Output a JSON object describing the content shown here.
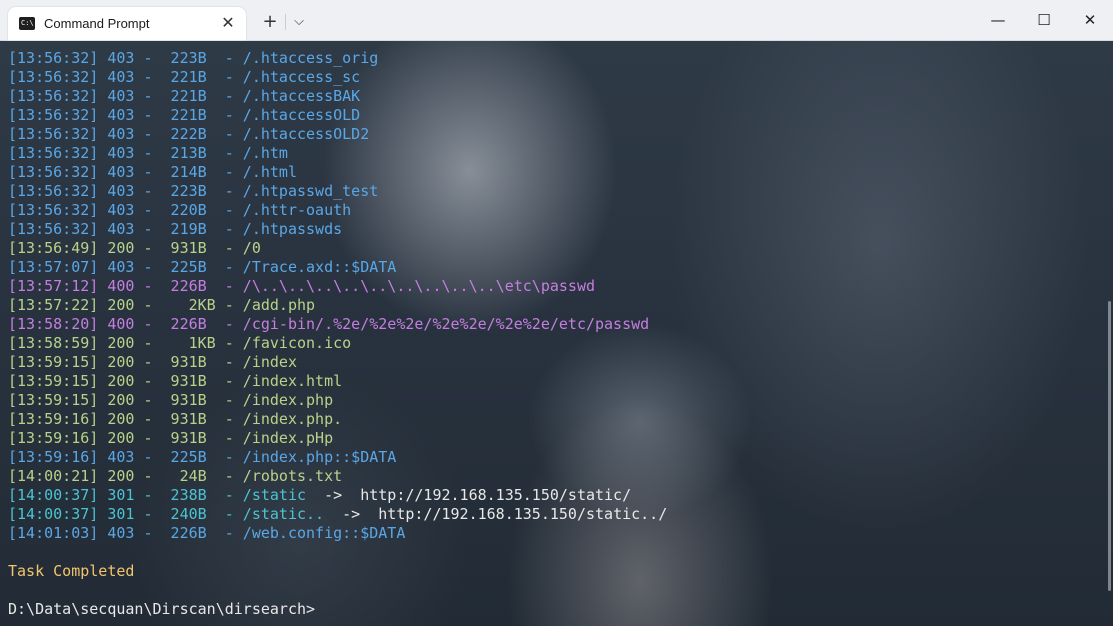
{
  "window": {
    "tab_title": "Command Prompt",
    "tab_icon_text": "C:\\",
    "tab_close": "✕",
    "new_tab": "+",
    "dropdown": "⌵",
    "minimize": "—",
    "maximize": "☐",
    "close": "✕"
  },
  "colors": {
    "403": "#5aa7e6",
    "200": "#b6d389",
    "400": "#c57ee0",
    "301": "#4cc3d2",
    "status_text": "#f2c56c",
    "prompt": "#e8e8e8"
  },
  "log": [
    {
      "text": "[13:56:32] 403 -  223B  - /.htaccess_orig",
      "code": "403"
    },
    {
      "text": "[13:56:32] 403 -  221B  - /.htaccess_sc",
      "code": "403"
    },
    {
      "text": "[13:56:32] 403 -  221B  - /.htaccessBAK",
      "code": "403"
    },
    {
      "text": "[13:56:32] 403 -  221B  - /.htaccessOLD",
      "code": "403"
    },
    {
      "text": "[13:56:32] 403 -  222B  - /.htaccessOLD2",
      "code": "403"
    },
    {
      "text": "[13:56:32] 403 -  213B  - /.htm",
      "code": "403"
    },
    {
      "text": "[13:56:32] 403 -  214B  - /.html",
      "code": "403"
    },
    {
      "text": "[13:56:32] 403 -  223B  - /.htpasswd_test",
      "code": "403"
    },
    {
      "text": "[13:56:32] 403 -  220B  - /.httr-oauth",
      "code": "403"
    },
    {
      "text": "[13:56:32] 403 -  219B  - /.htpasswds",
      "code": "403"
    },
    {
      "text": "[13:56:49] 200 -  931B  - /0",
      "code": "200"
    },
    {
      "text": "[13:57:07] 403 -  225B  - /Trace.axd::$DATA",
      "code": "403"
    },
    {
      "text": "[13:57:12] 400 -  226B  - /\\..\\..\\..\\..\\..\\..\\..\\..\\..\\etc\\passwd",
      "code": "400"
    },
    {
      "text": "[13:57:22] 200 -    2KB - /add.php",
      "code": "200"
    },
    {
      "text": "[13:58:20] 400 -  226B  - /cgi-bin/.%2e/%2e%2e/%2e%2e/%2e%2e/etc/passwd",
      "code": "400"
    },
    {
      "text": "[13:58:59] 200 -    1KB - /favicon.ico",
      "code": "200"
    },
    {
      "text": "[13:59:15] 200 -  931B  - /index",
      "code": "200"
    },
    {
      "text": "[13:59:15] 200 -  931B  - /index.html",
      "code": "200"
    },
    {
      "text": "[13:59:15] 200 -  931B  - /index.php",
      "code": "200"
    },
    {
      "text": "[13:59:16] 200 -  931B  - /index.php.",
      "code": "200"
    },
    {
      "text": "[13:59:16] 200 -  931B  - /index.pHp",
      "code": "200"
    },
    {
      "text": "[13:59:16] 403 -  225B  - /index.php::$DATA",
      "code": "403"
    },
    {
      "text": "[14:00:21] 200 -   24B  - /robots.txt",
      "code": "200"
    },
    {
      "text": "[14:00:37] 301 -  238B  - /static",
      "code": "301",
      "redirect": "  ->  http://192.168.135.150/static/"
    },
    {
      "text": "[14:00:37] 301 -  240B  - /static..",
      "code": "301",
      "redirect": "  ->  http://192.168.135.150/static../"
    },
    {
      "text": "[14:01:03] 403 -  226B  - /web.config::$DATA",
      "code": "403"
    }
  ],
  "status": "Task Completed",
  "prompt": "D:\\Data\\secquan\\Dirscan\\dirsearch>"
}
